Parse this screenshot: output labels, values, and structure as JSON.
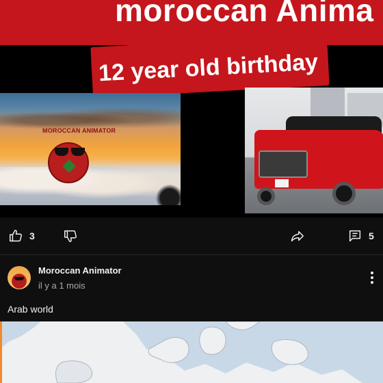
{
  "thumbnail": {
    "title_text": "moroccan Anima",
    "banner_text": "12 year old birthday",
    "watermark_text": "MOROCCAN ANIMATOR",
    "accent_color": "#c4161c"
  },
  "actions": {
    "like_count": "3",
    "comment_count": "5",
    "icons": [
      "thumbs-up-icon",
      "thumbs-down-icon",
      "share-icon",
      "comments-icon"
    ]
  },
  "comment": {
    "author": "Moroccan Animator",
    "time": "il y a 1 mois",
    "text": "Arab world",
    "more_icon": "more-vertical-icon"
  },
  "map": {
    "description_color": "#eef0f2",
    "edge_color": "#f0892a"
  }
}
